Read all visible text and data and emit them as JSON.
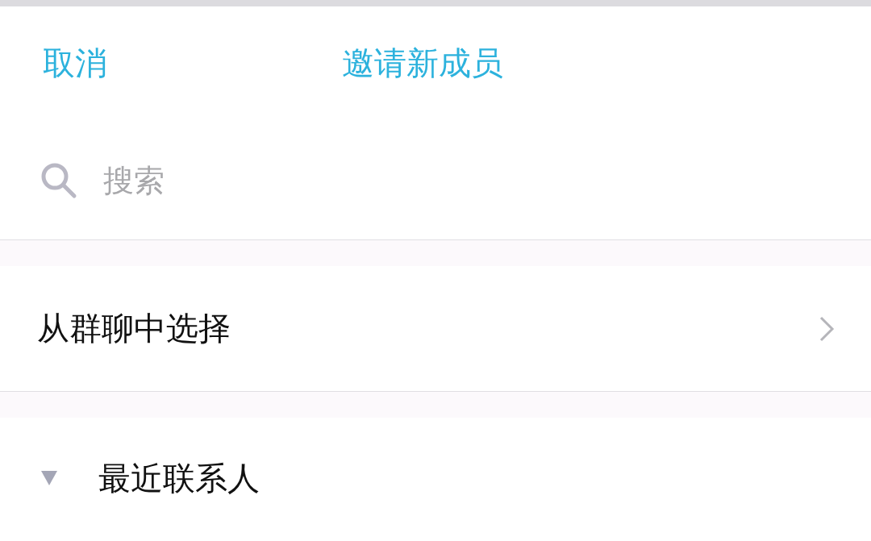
{
  "header": {
    "cancel": "取消",
    "title": "邀请新成员"
  },
  "search": {
    "placeholder": "搜索"
  },
  "menu_items": [
    {
      "label": "从群聊中选择"
    }
  ],
  "groups": [
    {
      "label": "最近联系人",
      "expanded": true
    }
  ]
}
